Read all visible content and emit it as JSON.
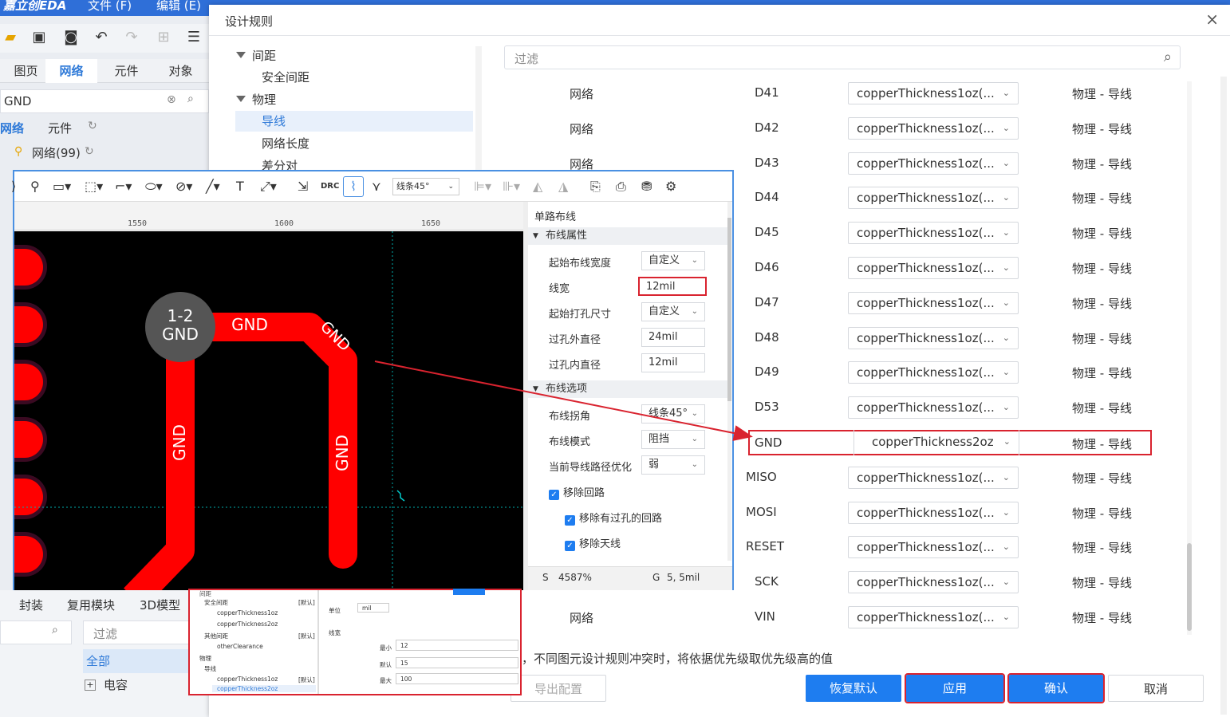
{
  "app": {
    "title_partial": "嘉立创EDA",
    "menus_left": [
      "文件 (F)",
      "编辑 (E)"
    ],
    "left_tabs": [
      "图页",
      "网络",
      "元件",
      "对象"
    ],
    "active_left_tab": "网络",
    "search_value": "GND",
    "subtabs": [
      "网络",
      "元件"
    ],
    "tree_root": "网络(99)",
    "bottom_tabs": [
      "封装",
      "复用模块",
      "3D模型"
    ],
    "bottom_filter": "过滤",
    "bottom_list": [
      "全部",
      "电容"
    ]
  },
  "dialog": {
    "title": "设计规则",
    "close": "×",
    "tree": [
      {
        "label": "间距",
        "level": 0
      },
      {
        "label": "安全间距",
        "level": 1
      },
      {
        "label": "物理",
        "level": 0
      },
      {
        "label": "导线",
        "level": 1,
        "selected": true
      },
      {
        "label": "网络长度",
        "level": 1
      },
      {
        "label": "差分对",
        "level": 1
      }
    ],
    "filter_placeholder": "过滤",
    "rows": [
      {
        "obj_type": "网络",
        "name": "D41",
        "rule": "copperThickness1oz(...",
        "category": "物理 - 导线"
      },
      {
        "obj_type": "网络",
        "name": "D42",
        "rule": "copperThickness1oz(...",
        "category": "物理 - 导线"
      },
      {
        "obj_type": "网络",
        "name": "D43",
        "rule": "copperThickness1oz(...",
        "category": "物理 - 导线"
      },
      {
        "obj_type": "",
        "name": "D44",
        "rule": "copperThickness1oz(...",
        "category": "物理 - 导线"
      },
      {
        "obj_type": "",
        "name": "D45",
        "rule": "copperThickness1oz(...",
        "category": "物理 - 导线"
      },
      {
        "obj_type": "",
        "name": "D46",
        "rule": "copperThickness1oz(...",
        "category": "物理 - 导线"
      },
      {
        "obj_type": "",
        "name": "D47",
        "rule": "copperThickness1oz(...",
        "category": "物理 - 导线"
      },
      {
        "obj_type": "",
        "name": "D48",
        "rule": "copperThickness1oz(...",
        "category": "物理 - 导线"
      },
      {
        "obj_type": "",
        "name": "D49",
        "rule": "copperThickness1oz(...",
        "category": "物理 - 导线"
      },
      {
        "obj_type": "",
        "name": "D53",
        "rule": "copperThickness1oz(...",
        "category": "物理 - 导线"
      },
      {
        "obj_type": "",
        "name": "GND",
        "rule": "copperThickness2oz",
        "category": "物理 - 导线",
        "highlight": true
      },
      {
        "obj_type": "",
        "name": "MISO",
        "rule": "copperThickness1oz(...",
        "category": "物理 - 导线"
      },
      {
        "obj_type": "",
        "name": "MOSI",
        "rule": "copperThickness1oz(...",
        "category": "物理 - 导线"
      },
      {
        "obj_type": "",
        "name": "RESET",
        "rule": "copperThickness1oz(...",
        "category": "物理 - 导线"
      },
      {
        "obj_type": "",
        "name": "SCK",
        "rule": "copperThickness1oz(...",
        "category": "物理 - 导线"
      },
      {
        "obj_type": "网络",
        "name": "VIN",
        "rule": "copperThickness1oz(...",
        "category": "物理 - 导线"
      }
    ],
    "note": "，不同图元设计规则冲突时，将依据优先级取优先级高的值",
    "buttons": {
      "export": "导出配置",
      "restore": "恢复默认",
      "apply": "应用",
      "ok": "确认",
      "cancel": "取消"
    }
  },
  "pcb": {
    "toolbar": {
      "drc": "DRC",
      "corner_select": "线条45°"
    },
    "ruler": [
      "1550",
      "1600",
      "1650"
    ],
    "via": {
      "line1": "1-2",
      "line2": "GND"
    },
    "track_labels": [
      "GND",
      "GND",
      "GND",
      "GND"
    ],
    "panel": {
      "title": "单路布线",
      "section1": "布线属性",
      "start_width_label": "起始布线宽度",
      "start_width_value": "自定义",
      "width_label": "线宽",
      "width_value": "12mil",
      "start_via_label": "起始打孔尺寸",
      "start_via_value": "自定义",
      "via_outer_label": "过孔外直径",
      "via_outer_value": "24mil",
      "via_inner_label": "过孔内直径",
      "via_inner_value": "12mil",
      "section2": "布线选项",
      "corner_label": "布线拐角",
      "corner_value": "线条45°",
      "mode_label": "布线模式",
      "mode_value": "阻挡",
      "optimize_label": "当前导线路径优化",
      "optimize_value": "弱",
      "remove_loop": "移除回路",
      "remove_via_loop": "移除有过孔的回路",
      "remove_antenna": "移除天线"
    },
    "status": {
      "s": "S",
      "s_value": "4587%",
      "g": "G",
      "g_value": "5, 5mil"
    }
  },
  "thumb": {
    "tree": [
      "间距",
      "安全间距",
      "copperThickness1oz",
      "copperThickness2oz",
      "其他间距",
      "otherClearance",
      "物理",
      "导线",
      "copperThickness1oz",
      "copperThickness2oz"
    ],
    "default_tag": "[默认]",
    "unit_label": "单位",
    "unit_value": "mil",
    "line_label": "线宽",
    "min_label": "最小",
    "min_value": "12",
    "default_label": "默认",
    "default_value": "15",
    "max_label": "最大",
    "max_value": "100"
  }
}
